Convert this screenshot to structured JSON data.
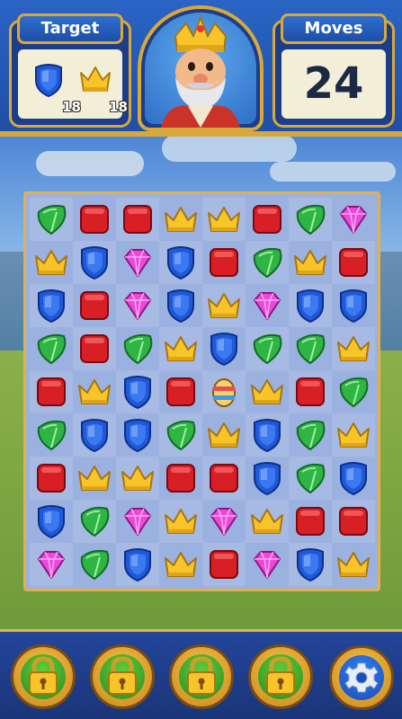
{
  "header": {
    "target": {
      "title": "Target",
      "goals": [
        {
          "icon": "blue-shield-icon",
          "count": "18"
        },
        {
          "icon": "yellow-crown-icon",
          "count": "18"
        }
      ]
    },
    "moves": {
      "title": "Moves",
      "value": "24"
    },
    "avatar": {
      "icon": "king-avatar-icon"
    }
  },
  "board": {
    "columns": 8,
    "rows": 9,
    "grid": [
      [
        "leaf",
        "box",
        "box",
        "crown",
        "crown",
        "box",
        "leaf",
        "gem"
      ],
      [
        "crown",
        "shield",
        "gem",
        "shield",
        "box",
        "leaf",
        "crown",
        "box"
      ],
      [
        "shield",
        "box",
        "gem",
        "shield",
        "crown",
        "gem",
        "shield",
        "shield"
      ],
      [
        "leaf",
        "box",
        "leaf",
        "crown",
        "shield",
        "leaf",
        "leaf",
        "crown"
      ],
      [
        "box",
        "crown",
        "shield",
        "box",
        "egg",
        "crown",
        "box",
        "leaf"
      ],
      [
        "leaf",
        "shield",
        "shield",
        "leaf",
        "crown",
        "shield",
        "leaf",
        "crown"
      ],
      [
        "box",
        "crown",
        "crown",
        "box",
        "box",
        "shield",
        "leaf",
        "shield"
      ],
      [
        "shield",
        "leaf",
        "gem",
        "crown",
        "gem",
        "crown",
        "box",
        "box"
      ],
      [
        "gem",
        "leaf",
        "shield",
        "crown",
        "box",
        "gem",
        "shield",
        "crown"
      ]
    ],
    "piece_colors": {
      "leaf": "#2fb544",
      "box": "#d81f26",
      "crown": "#f7c52a",
      "gem": "#e94ad9",
      "shield": "#1f58d8",
      "egg": "#e64d4d"
    }
  },
  "boosters": [
    {
      "icon": "locked-booster-icon"
    },
    {
      "icon": "locked-booster-icon"
    },
    {
      "icon": "locked-booster-icon"
    },
    {
      "icon": "locked-booster-icon"
    }
  ],
  "settings": {
    "icon": "gear-icon"
  }
}
